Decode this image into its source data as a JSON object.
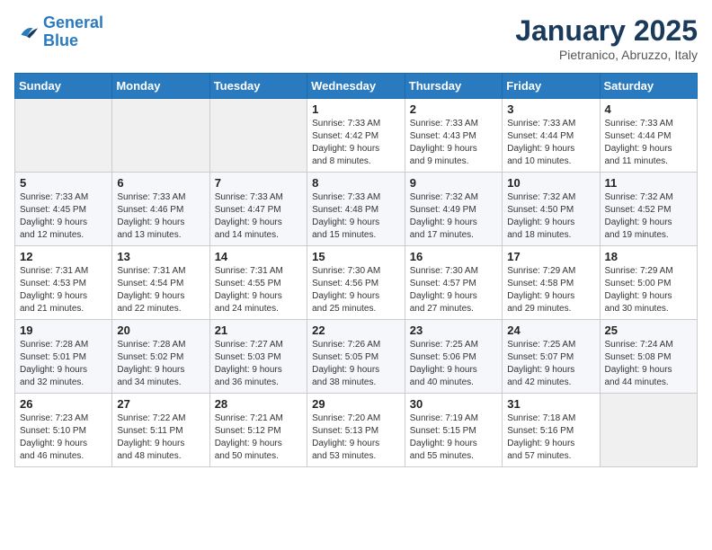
{
  "header": {
    "logo_line1": "General",
    "logo_line2": "Blue",
    "month": "January 2025",
    "location": "Pietranico, Abruzzo, Italy"
  },
  "weekdays": [
    "Sunday",
    "Monday",
    "Tuesday",
    "Wednesday",
    "Thursday",
    "Friday",
    "Saturday"
  ],
  "weeks": [
    [
      {
        "day": "",
        "info": ""
      },
      {
        "day": "",
        "info": ""
      },
      {
        "day": "",
        "info": ""
      },
      {
        "day": "1",
        "info": "Sunrise: 7:33 AM\nSunset: 4:42 PM\nDaylight: 9 hours\nand 8 minutes."
      },
      {
        "day": "2",
        "info": "Sunrise: 7:33 AM\nSunset: 4:43 PM\nDaylight: 9 hours\nand 9 minutes."
      },
      {
        "day": "3",
        "info": "Sunrise: 7:33 AM\nSunset: 4:44 PM\nDaylight: 9 hours\nand 10 minutes."
      },
      {
        "day": "4",
        "info": "Sunrise: 7:33 AM\nSunset: 4:44 PM\nDaylight: 9 hours\nand 11 minutes."
      }
    ],
    [
      {
        "day": "5",
        "info": "Sunrise: 7:33 AM\nSunset: 4:45 PM\nDaylight: 9 hours\nand 12 minutes."
      },
      {
        "day": "6",
        "info": "Sunrise: 7:33 AM\nSunset: 4:46 PM\nDaylight: 9 hours\nand 13 minutes."
      },
      {
        "day": "7",
        "info": "Sunrise: 7:33 AM\nSunset: 4:47 PM\nDaylight: 9 hours\nand 14 minutes."
      },
      {
        "day": "8",
        "info": "Sunrise: 7:33 AM\nSunset: 4:48 PM\nDaylight: 9 hours\nand 15 minutes."
      },
      {
        "day": "9",
        "info": "Sunrise: 7:32 AM\nSunset: 4:49 PM\nDaylight: 9 hours\nand 17 minutes."
      },
      {
        "day": "10",
        "info": "Sunrise: 7:32 AM\nSunset: 4:50 PM\nDaylight: 9 hours\nand 18 minutes."
      },
      {
        "day": "11",
        "info": "Sunrise: 7:32 AM\nSunset: 4:52 PM\nDaylight: 9 hours\nand 19 minutes."
      }
    ],
    [
      {
        "day": "12",
        "info": "Sunrise: 7:31 AM\nSunset: 4:53 PM\nDaylight: 9 hours\nand 21 minutes."
      },
      {
        "day": "13",
        "info": "Sunrise: 7:31 AM\nSunset: 4:54 PM\nDaylight: 9 hours\nand 22 minutes."
      },
      {
        "day": "14",
        "info": "Sunrise: 7:31 AM\nSunset: 4:55 PM\nDaylight: 9 hours\nand 24 minutes."
      },
      {
        "day": "15",
        "info": "Sunrise: 7:30 AM\nSunset: 4:56 PM\nDaylight: 9 hours\nand 25 minutes."
      },
      {
        "day": "16",
        "info": "Sunrise: 7:30 AM\nSunset: 4:57 PM\nDaylight: 9 hours\nand 27 minutes."
      },
      {
        "day": "17",
        "info": "Sunrise: 7:29 AM\nSunset: 4:58 PM\nDaylight: 9 hours\nand 29 minutes."
      },
      {
        "day": "18",
        "info": "Sunrise: 7:29 AM\nSunset: 5:00 PM\nDaylight: 9 hours\nand 30 minutes."
      }
    ],
    [
      {
        "day": "19",
        "info": "Sunrise: 7:28 AM\nSunset: 5:01 PM\nDaylight: 9 hours\nand 32 minutes."
      },
      {
        "day": "20",
        "info": "Sunrise: 7:28 AM\nSunset: 5:02 PM\nDaylight: 9 hours\nand 34 minutes."
      },
      {
        "day": "21",
        "info": "Sunrise: 7:27 AM\nSunset: 5:03 PM\nDaylight: 9 hours\nand 36 minutes."
      },
      {
        "day": "22",
        "info": "Sunrise: 7:26 AM\nSunset: 5:05 PM\nDaylight: 9 hours\nand 38 minutes."
      },
      {
        "day": "23",
        "info": "Sunrise: 7:25 AM\nSunset: 5:06 PM\nDaylight: 9 hours\nand 40 minutes."
      },
      {
        "day": "24",
        "info": "Sunrise: 7:25 AM\nSunset: 5:07 PM\nDaylight: 9 hours\nand 42 minutes."
      },
      {
        "day": "25",
        "info": "Sunrise: 7:24 AM\nSunset: 5:08 PM\nDaylight: 9 hours\nand 44 minutes."
      }
    ],
    [
      {
        "day": "26",
        "info": "Sunrise: 7:23 AM\nSunset: 5:10 PM\nDaylight: 9 hours\nand 46 minutes."
      },
      {
        "day": "27",
        "info": "Sunrise: 7:22 AM\nSunset: 5:11 PM\nDaylight: 9 hours\nand 48 minutes."
      },
      {
        "day": "28",
        "info": "Sunrise: 7:21 AM\nSunset: 5:12 PM\nDaylight: 9 hours\nand 50 minutes."
      },
      {
        "day": "29",
        "info": "Sunrise: 7:20 AM\nSunset: 5:13 PM\nDaylight: 9 hours\nand 53 minutes."
      },
      {
        "day": "30",
        "info": "Sunrise: 7:19 AM\nSunset: 5:15 PM\nDaylight: 9 hours\nand 55 minutes."
      },
      {
        "day": "31",
        "info": "Sunrise: 7:18 AM\nSunset: 5:16 PM\nDaylight: 9 hours\nand 57 minutes."
      },
      {
        "day": "",
        "info": ""
      }
    ]
  ]
}
